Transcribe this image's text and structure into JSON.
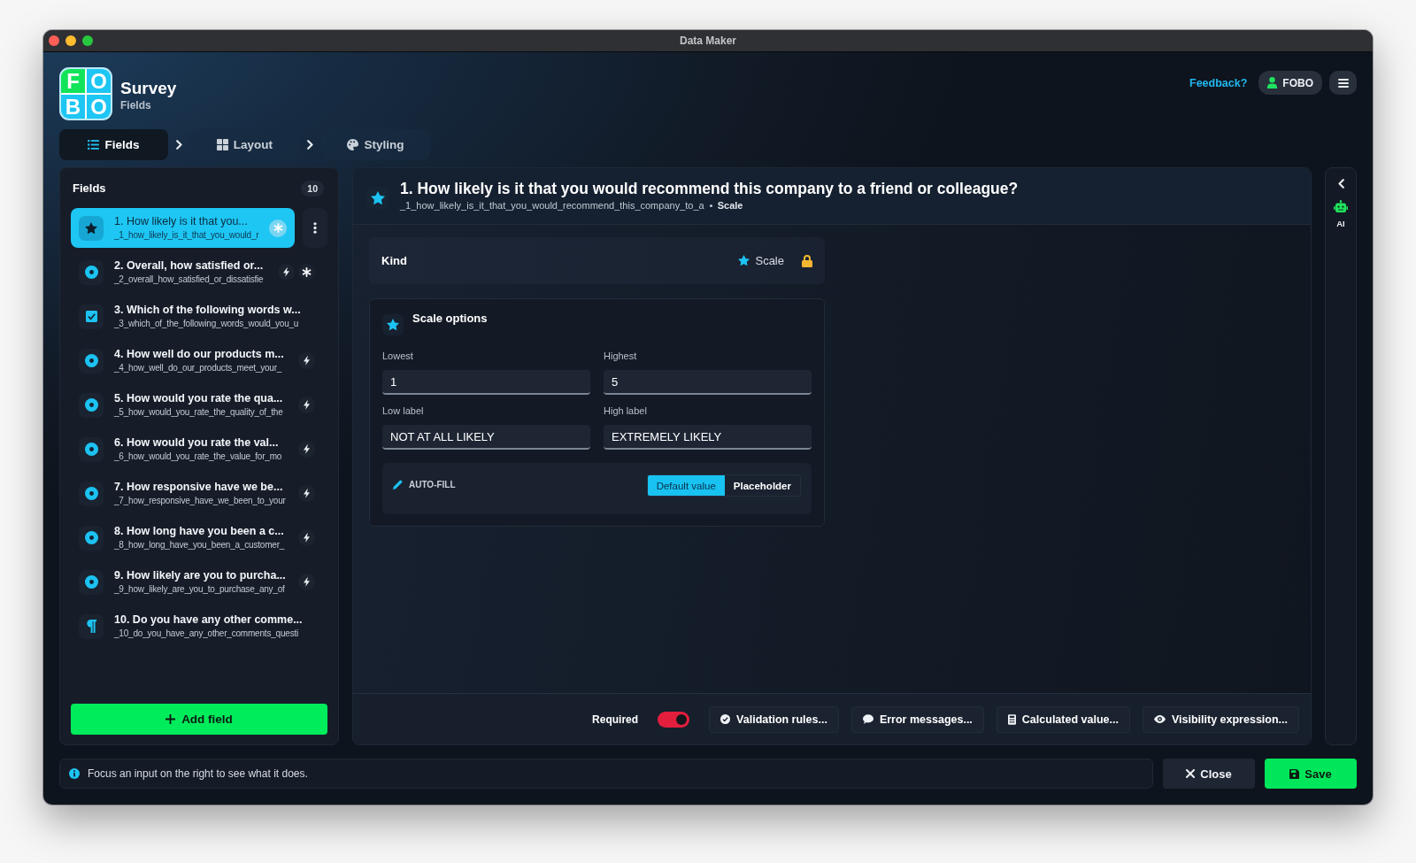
{
  "window": {
    "title": "Data Maker"
  },
  "app": {
    "logo_letters": [
      "F",
      "O",
      "B",
      "O"
    ],
    "title": "Survey",
    "subtitle": "Fields"
  },
  "header": {
    "feedback": "Feedback?",
    "user": "FOBO"
  },
  "tabs": [
    {
      "label": "Fields",
      "selected": true
    },
    {
      "label": "Layout",
      "selected": false
    },
    {
      "label": "Styling",
      "selected": false
    }
  ],
  "fields_panel": {
    "title": "Fields",
    "count": "10",
    "items": [
      {
        "title": "1. How likely is it that you...",
        "key": "_1_how_likely_is_it_that_you_would_r",
        "kind": "scale",
        "selected": true,
        "logic": false,
        "required": true
      },
      {
        "title": "2. Overall, how satisfied or...",
        "key": "_2_overall_how_satisfied_or_dissatisfie",
        "kind": "choice",
        "selected": false,
        "logic": true,
        "required": true
      },
      {
        "title": "3. Which of the following words w...",
        "key": "_3_which_of_the_following_words_would_you_u",
        "kind": "checkboxes",
        "selected": false,
        "logic": false,
        "required": false
      },
      {
        "title": "4. How well do our products m...",
        "key": "_4_how_well_do_our_products_meet_your_",
        "kind": "choice",
        "selected": false,
        "logic": true,
        "required": false
      },
      {
        "title": "5. How would you rate the qua...",
        "key": "_5_how_would_you_rate_the_quality_of_the",
        "kind": "choice",
        "selected": false,
        "logic": true,
        "required": false
      },
      {
        "title": "6. How would you rate the val...",
        "key": "_6_how_would_you_rate_the_value_for_mo",
        "kind": "choice",
        "selected": false,
        "logic": true,
        "required": false
      },
      {
        "title": "7. How responsive have we be...",
        "key": "_7_how_responsive_have_we_been_to_your",
        "kind": "choice",
        "selected": false,
        "logic": true,
        "required": false
      },
      {
        "title": "8. How long have you been a c...",
        "key": "_8_how_long_have_you_been_a_customer_",
        "kind": "choice",
        "selected": false,
        "logic": true,
        "required": false
      },
      {
        "title": "9. How likely are you to purcha...",
        "key": "_9_how_likely_are_you_to_purchase_any_of",
        "kind": "choice",
        "selected": false,
        "logic": true,
        "required": false
      },
      {
        "title": "10. Do you have any other comme...",
        "key": "_10_do_you_have_any_other_comments_questi",
        "kind": "text",
        "selected": false,
        "logic": false,
        "required": false
      }
    ],
    "add_button": "Add field"
  },
  "editor": {
    "title": "1. How likely is it that you would recommend this company to a friend or colleague?",
    "key": "_1_how_likely_is_it_that_you_would_recommend_this_company_to_a",
    "kind_name": "Scale",
    "kind_card": {
      "label": "Kind",
      "value": "Scale",
      "locked": true
    },
    "options": {
      "title": "Scale options",
      "inputs": [
        {
          "label": "Lowest",
          "value": "1"
        },
        {
          "label": "Highest",
          "value": "5"
        },
        {
          "label": "Low label",
          "value": "NOT AT ALL LIKELY"
        },
        {
          "label": "High label",
          "value": "EXTREMELY LIKELY"
        }
      ],
      "autofill": {
        "label": "AUTO-FILL",
        "modes": [
          {
            "label": "Default value",
            "selected": true
          },
          {
            "label": "Placeholder",
            "selected": false
          }
        ]
      }
    },
    "footer": {
      "required": {
        "label": "Required",
        "on": true
      },
      "buttons": [
        "Validation rules...",
        "Error messages...",
        "Calculated value...",
        "Visibility expression..."
      ]
    }
  },
  "ai_panel": {
    "label": "AI"
  },
  "status_bar": {
    "message": "Focus an input on the right to see what it does."
  },
  "actions": {
    "close": "Close",
    "save": "Save"
  }
}
